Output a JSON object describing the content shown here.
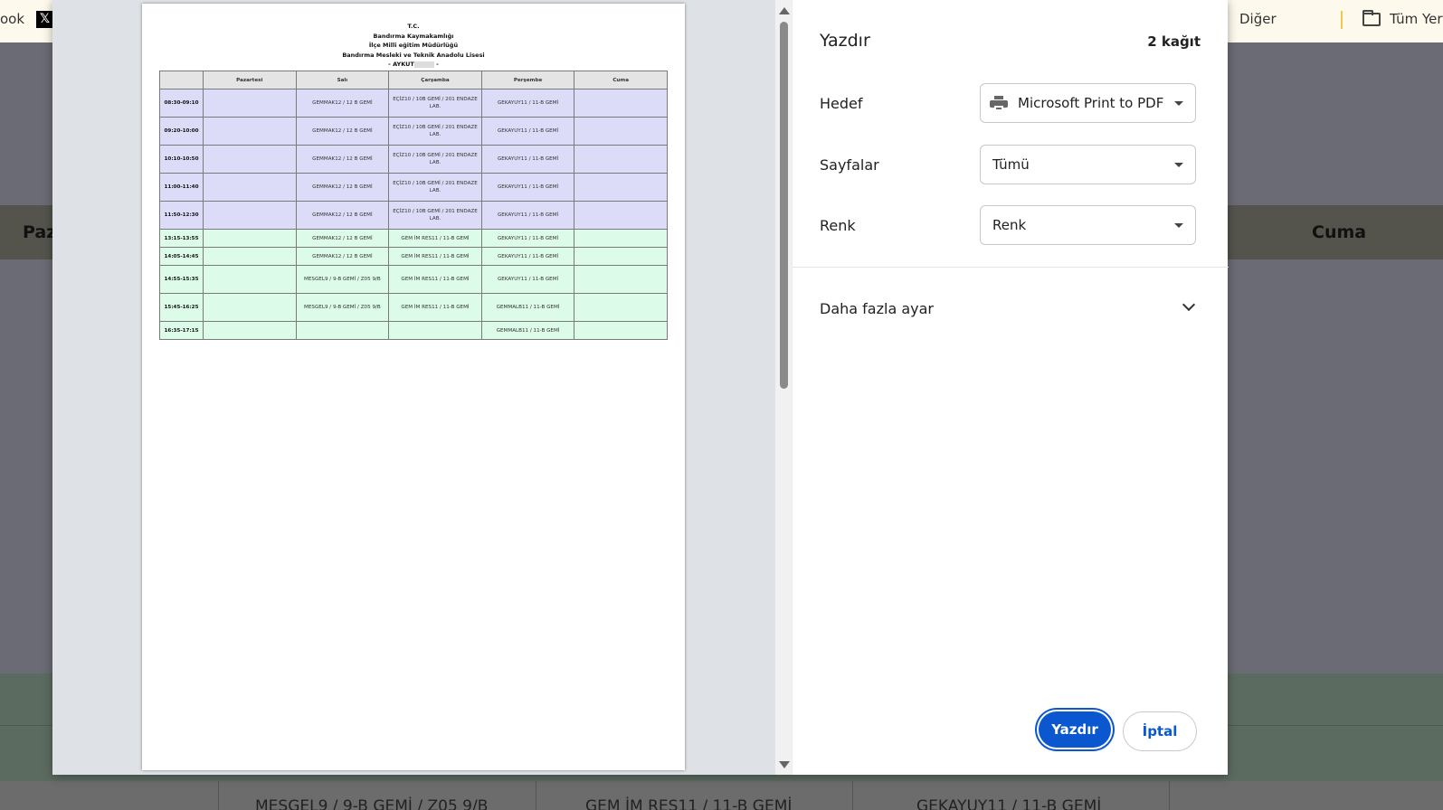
{
  "bookmarks": {
    "left_partial": "ook",
    "x_icon": "x-logo-icon",
    "other": "Diğer",
    "all": "Tüm Yer"
  },
  "background_page": {
    "header_left": "Paz",
    "header_right": "Cuma",
    "bottom_cells": [
      "MESGEL9 / 9-B GEMİ / Z05 9/B",
      "GEM İM RES11 / 11-B GEMİ",
      "GEKAYUY11 / 11-B GEMİ"
    ]
  },
  "preview": {
    "title_lines": [
      "T.C.",
      "Bandırma Kaymakamlığı",
      "İlçe Milli eğitim Müdürlüğü",
      "Bandırma Mesleki ve Teknik Anadolu Lisesi"
    ],
    "teacher_prefix": "- AYKUT",
    "teacher_suffix": "-",
    "days": [
      "Pazartesi",
      "Salı",
      "Çarşamba",
      "Perşembe",
      "Cuma"
    ],
    "rows": [
      {
        "time": "08:30-09:10",
        "cells": [
          "",
          "GEMMAK12 / 12 B GEMİ",
          "EÇİZ10 / 10B GEMİ / 201 ENDAZE LAB.",
          "GEKAYUY11 / 11-B GEMİ",
          ""
        ]
      },
      {
        "time": "09:20-10:00",
        "cells": [
          "",
          "GEMMAK12 / 12 B GEMİ",
          "EÇİZ10 / 10B GEMİ / 201 ENDAZE LAB.",
          "GEKAYUY11 / 11-B GEMİ",
          ""
        ]
      },
      {
        "time": "10:10-10:50",
        "cells": [
          "",
          "GEMMAK12 / 12 B GEMİ",
          "EÇİZ10 / 10B GEMİ / 201 ENDAZE LAB.",
          "GEKAYUY11 / 11-B GEMİ",
          ""
        ]
      },
      {
        "time": "11:00-11:40",
        "cells": [
          "",
          "GEMMAK12 / 12 B GEMİ",
          "EÇİZ10 / 10B GEMİ / 201 ENDAZE LAB.",
          "GEKAYUY11 / 11-B GEMİ",
          ""
        ]
      },
      {
        "time": "11:50-12:30",
        "cells": [
          "",
          "GEMMAK12 / 12 B GEMİ",
          "EÇİZ10 / 10B GEMİ / 201 ENDAZE LAB.",
          "GEKAYUY11 / 11-B GEMİ",
          ""
        ]
      },
      {
        "time": "13:15-13:55",
        "cells": [
          "",
          "GEMMAK12 / 12 B GEMİ",
          "GEM İM RES11 / 11-B GEMİ",
          "GEKAYUY11 / 11-B GEMİ",
          ""
        ]
      },
      {
        "time": "14:05-14:45",
        "cells": [
          "",
          "GEMMAK12 / 12 B GEMİ",
          "GEM İM RES11 / 11-B GEMİ",
          "GEKAYUY11 / 11-B GEMİ",
          ""
        ]
      },
      {
        "time": "14:55-15:35",
        "cells": [
          "",
          "MESGEL9 / 9-B GEMİ / Z05 9/B",
          "GEM İM RES11 / 11-B GEMİ",
          "GEKAYUY11 / 11-B GEMİ",
          ""
        ]
      },
      {
        "time": "15:45-16:25",
        "cells": [
          "",
          "MESGEL9 / 9-B GEMİ / Z05 9/B",
          "GEM İM RES11 / 11-B GEMİ",
          "GEMMALB11 / 11-B GEMİ",
          ""
        ]
      },
      {
        "time": "16:35-17:15",
        "cells": [
          "",
          "",
          "",
          "GEMMALB11 / 11-B GEMİ",
          ""
        ]
      }
    ]
  },
  "settings": {
    "title": "Yazdır",
    "sheets": "2 kağıt",
    "destination_label": "Hedef",
    "destination_value": "Microsoft Print to PDF",
    "pages_label": "Sayfalar",
    "pages_value": "Tümü",
    "color_label": "Renk",
    "color_value": "Renk",
    "more_settings": "Daha fazla ayar",
    "print_button": "Yazdır",
    "cancel_button": "İptal"
  },
  "colors": {
    "accent": "#0b57d0",
    "morning_row": "#dcdcf8",
    "afternoon_row": "#dcfbe8"
  }
}
